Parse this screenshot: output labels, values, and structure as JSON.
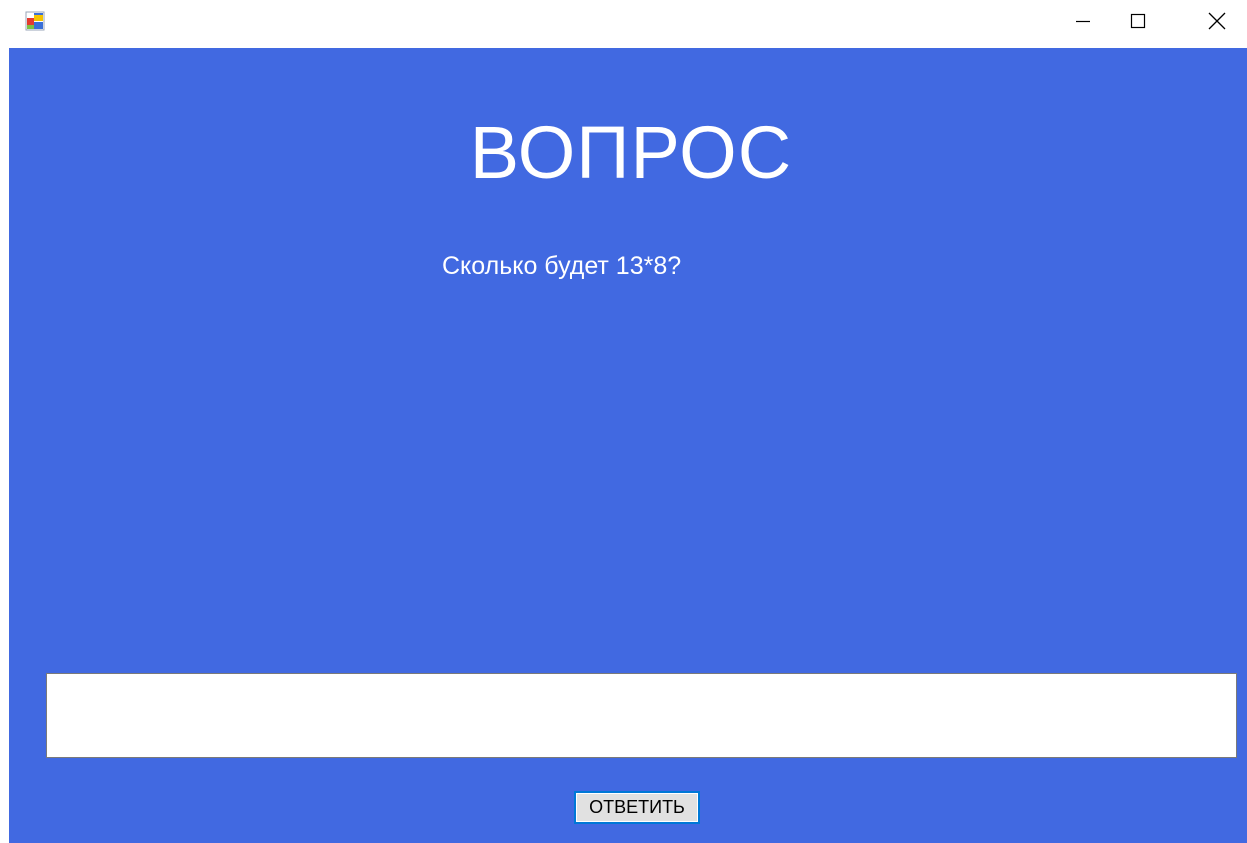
{
  "window": {
    "icon": "app-form-icon",
    "controls": {
      "minimize_icon": "minimize-icon",
      "maximize_icon": "maximize-icon",
      "close_icon": "close-icon"
    },
    "background_color": "#4169e1"
  },
  "main": {
    "heading": "ВОПРОС",
    "question": "Сколько будет 13*8?",
    "answer_input": {
      "value": "",
      "placeholder": ""
    },
    "submit_label": "ОТВЕТИТЬ"
  }
}
